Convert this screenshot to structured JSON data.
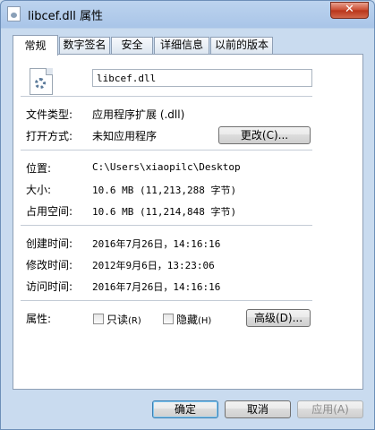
{
  "window": {
    "title": "libcef.dll 属性",
    "close_label": "✕"
  },
  "tabs": [
    "常规",
    "数字签名",
    "安全",
    "详细信息",
    "以前的版本"
  ],
  "general": {
    "file_name": "libcef.dll",
    "file_type_label": "文件类型:",
    "file_type_value": "应用程序扩展 (.dll)",
    "open_with_label": "打开方式:",
    "open_with_value": "未知应用程序",
    "change_button": "更改(C)...",
    "location_label": "位置:",
    "location_value": "C:\\Users\\xiaopilc\\Desktop",
    "size_label": "大小:",
    "size_value": "10.6 MB (11,213,288 字节)",
    "size_on_disk_label": "占用空间:",
    "size_on_disk_value": "10.6 MB (11,214,848 字节)",
    "created_label": "创建时间:",
    "created_value": "2016年7月26日，14:16:16",
    "modified_label": "修改时间:",
    "modified_value": "2012年9月6日，13:23:06",
    "accessed_label": "访问时间:",
    "accessed_value": "2016年7月26日，14:16:16",
    "attributes_label": "属性:",
    "readonly_label": "只读",
    "readonly_key": "(R)",
    "hidden_label": "隐藏",
    "hidden_key": "(H)",
    "advanced_button": "高级(D)..."
  },
  "footer": {
    "ok": "确定",
    "cancel": "取消",
    "apply": "应用(A)"
  },
  "colors": {
    "window_frame": "#c9dbef",
    "close_button": "#c94a2e",
    "default_button_border": "#3c7fb1"
  }
}
